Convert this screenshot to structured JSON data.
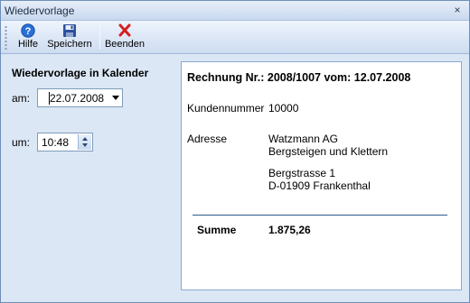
{
  "window": {
    "title": "Wiedervorlage",
    "close_glyph": "×"
  },
  "toolbar": {
    "help_label": "Hilfe",
    "save_label": "Speichern",
    "exit_label": "Beenden"
  },
  "left": {
    "title": "Wiedervorlage in Kalender",
    "date_label": "am:",
    "date_value": "22.07.2008",
    "time_label": "um:",
    "time_value": "10:48"
  },
  "invoice": {
    "heading": "Rechnung Nr.: 2008/1007 vom: 12.07.2008",
    "customer_number_label": "Kundennummer",
    "customer_number_value": "10000",
    "address_label": "Adresse",
    "address_line1": "Watzmann AG",
    "address_line2": "Bergsteigen und Klettern",
    "address_line3": "Bergstrasse 1",
    "address_line4": "D-01909 Frankenthal",
    "sum_label": "Summe",
    "sum_value": "1.875,26"
  },
  "icons": {
    "help": "help-icon",
    "save": "floppy-disk-icon",
    "exit": "red-x-icon"
  },
  "colors": {
    "window_bg": "#dbe7f5",
    "help_icon": "#2a6fd6",
    "save_icon": "#2d4f9e",
    "exit_icon": "#d42020",
    "divider": "#2f5a8a"
  }
}
